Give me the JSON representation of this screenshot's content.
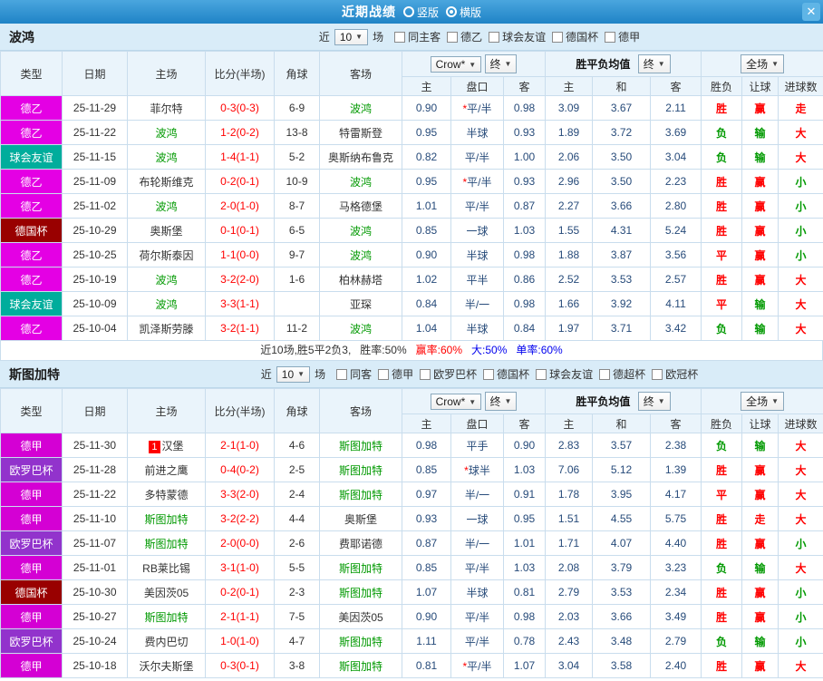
{
  "titlebar": {
    "title": "近期战绩",
    "options": [
      {
        "label": "竖版",
        "selected": false
      },
      {
        "label": "横版",
        "selected": true
      }
    ],
    "close_label": "✕"
  },
  "colors": {
    "red": "#ff0000",
    "green": "#009900",
    "blue": "#0000ee",
    "focal": "#009900",
    "score": "#ff0000",
    "league": {
      "德乙": "#e400e4",
      "德甲": "#d400d4",
      "球会友谊": "#00ad9c",
      "德国杯": "#990000",
      "欧罗巴杯": "#9233cc"
    }
  },
  "table_header": {
    "type": "类型",
    "date": "日期",
    "home": "主场",
    "score": "比分(半场)",
    "corner": "角球",
    "away": "客场",
    "bookmaker": "Crow*",
    "final": "终",
    "avg_label": "胜平负均值",
    "scope": "全场",
    "sub": {
      "home_odds": "主",
      "handicap": "盘口",
      "away_odds": "客",
      "win": "主",
      "draw": "和",
      "lose": "客",
      "result": "胜负",
      "asian": "让球",
      "goals": "进球数"
    }
  },
  "sections": [
    {
      "team": "波鸿",
      "filter": {
        "near": "近",
        "count": "10",
        "games": "场",
        "checkboxes": [
          "同主客",
          "德乙",
          "球会友谊",
          "德国杯",
          "德甲"
        ]
      },
      "rows": [
        {
          "league": "德乙",
          "date": "25-11-29",
          "home": "菲尔特",
          "home_focal": false,
          "score": "0-3(0-3)",
          "corner": "6-9",
          "away": "波鸿",
          "away_focal": true,
          "home_odds": "0.90",
          "handicap": "*平/半",
          "away_odds": "0.98",
          "avg_win": "3.09",
          "avg_draw": "3.67",
          "avg_lose": "2.11",
          "result": "胜",
          "result_color": "red",
          "asian": "赢",
          "asian_color": "red",
          "goals": "走",
          "goals_color": "red"
        },
        {
          "league": "德乙",
          "date": "25-11-22",
          "home": "波鸿",
          "home_focal": true,
          "score": "1-2(0-2)",
          "corner": "13-8",
          "away": "特雷斯登",
          "away_focal": false,
          "home_odds": "0.95",
          "handicap": "半球",
          "away_odds": "0.93",
          "avg_win": "1.89",
          "avg_draw": "3.72",
          "avg_lose": "3.69",
          "result": "负",
          "result_color": "green",
          "asian": "输",
          "asian_color": "green",
          "goals": "大",
          "goals_color": "red"
        },
        {
          "league": "球会友谊",
          "date": "25-11-15",
          "home": "波鸿",
          "home_focal": true,
          "score": "1-4(1-1)",
          "corner": "5-2",
          "away": "奥斯纳布鲁克",
          "away_focal": false,
          "home_odds": "0.82",
          "handicap": "平/半",
          "away_odds": "1.00",
          "avg_win": "2.06",
          "avg_draw": "3.50",
          "avg_lose": "3.04",
          "result": "负",
          "result_color": "green",
          "asian": "输",
          "asian_color": "green",
          "goals": "大",
          "goals_color": "red"
        },
        {
          "league": "德乙",
          "date": "25-11-09",
          "home": "布轮斯维克",
          "home_focal": false,
          "score": "0-2(0-1)",
          "corner": "10-9",
          "away": "波鸿",
          "away_focal": true,
          "home_odds": "0.95",
          "handicap": "*平/半",
          "away_odds": "0.93",
          "avg_win": "2.96",
          "avg_draw": "3.50",
          "avg_lose": "2.23",
          "result": "胜",
          "result_color": "red",
          "asian": "赢",
          "asian_color": "red",
          "goals": "小",
          "goals_color": "green"
        },
        {
          "league": "德乙",
          "date": "25-11-02",
          "home": "波鸿",
          "home_focal": true,
          "score": "2-0(1-0)",
          "corner": "8-7",
          "away": "马格德堡",
          "away_focal": false,
          "home_odds": "1.01",
          "handicap": "平/半",
          "away_odds": "0.87",
          "avg_win": "2.27",
          "avg_draw": "3.66",
          "avg_lose": "2.80",
          "result": "胜",
          "result_color": "red",
          "asian": "赢",
          "asian_color": "red",
          "goals": "小",
          "goals_color": "green"
        },
        {
          "league": "德国杯",
          "date": "25-10-29",
          "home": "奥斯堡",
          "home_focal": false,
          "score": "0-1(0-1)",
          "corner": "6-5",
          "away": "波鸿",
          "away_focal": true,
          "home_odds": "0.85",
          "handicap": "一球",
          "away_odds": "1.03",
          "avg_win": "1.55",
          "avg_draw": "4.31",
          "avg_lose": "5.24",
          "result": "胜",
          "result_color": "red",
          "asian": "赢",
          "asian_color": "red",
          "goals": "小",
          "goals_color": "green"
        },
        {
          "league": "德乙",
          "date": "25-10-25",
          "home": "荷尔斯泰因",
          "home_focal": false,
          "score": "1-1(0-0)",
          "corner": "9-7",
          "away": "波鸿",
          "away_focal": true,
          "home_odds": "0.90",
          "handicap": "半球",
          "away_odds": "0.98",
          "avg_win": "1.88",
          "avg_draw": "3.87",
          "avg_lose": "3.56",
          "result": "平",
          "result_color": "red",
          "asian": "赢",
          "asian_color": "red",
          "goals": "小",
          "goals_color": "green"
        },
        {
          "league": "德乙",
          "date": "25-10-19",
          "home": "波鸿",
          "home_focal": true,
          "score": "3-2(2-0)",
          "corner": "1-6",
          "away": "柏林赫塔",
          "away_focal": false,
          "home_odds": "1.02",
          "handicap": "平半",
          "away_odds": "0.86",
          "avg_win": "2.52",
          "avg_draw": "3.53",
          "avg_lose": "2.57",
          "result": "胜",
          "result_color": "red",
          "asian": "赢",
          "asian_color": "red",
          "goals": "大",
          "goals_color": "red"
        },
        {
          "league": "球会友谊",
          "date": "25-10-09",
          "home": "波鸿",
          "home_focal": true,
          "score": "3-3(1-1)",
          "corner": "",
          "away": "亚琛",
          "away_focal": false,
          "home_odds": "0.84",
          "handicap": "半/一",
          "away_odds": "0.98",
          "avg_win": "1.66",
          "avg_draw": "3.92",
          "avg_lose": "4.11",
          "result": "平",
          "result_color": "red",
          "asian": "输",
          "asian_color": "green",
          "goals": "大",
          "goals_color": "red"
        },
        {
          "league": "德乙",
          "date": "25-10-04",
          "home": "凯泽斯劳滕",
          "home_focal": false,
          "score": "3-2(1-1)",
          "corner": "11-2",
          "away": "波鸿",
          "away_focal": true,
          "home_odds": "1.04",
          "handicap": "半球",
          "away_odds": "0.84",
          "avg_win": "1.97",
          "avg_draw": "3.71",
          "avg_lose": "3.42",
          "result": "负",
          "result_color": "green",
          "asian": "输",
          "asian_color": "green",
          "goals": "大",
          "goals_color": "red"
        }
      ],
      "summary": [
        {
          "text": "近10场,胜5平2负3,",
          "color": "#333333"
        },
        {
          "text": "胜率:50%",
          "color": "#333333"
        },
        {
          "text": "赢率:60%",
          "color": "#ff0000"
        },
        {
          "text": "大:50%",
          "color": "#0000ee"
        },
        {
          "text": "单率:60%",
          "color": "#0000ee"
        }
      ]
    },
    {
      "team": "斯图加特",
      "filter": {
        "near": "近",
        "count": "10",
        "games": "场",
        "checkboxes": [
          "同客",
          "德甲",
          "欧罗巴杯",
          "德国杯",
          "球会友谊",
          "德超杯",
          "欧冠杯"
        ]
      },
      "rows": [
        {
          "league": "德甲",
          "date": "25-11-30",
          "home": "汉堡",
          "home_badge": "1",
          "home_focal": false,
          "score": "2-1(1-0)",
          "corner": "4-6",
          "away": "斯图加特",
          "away_focal": true,
          "home_odds": "0.98",
          "handicap": "平手",
          "away_odds": "0.90",
          "avg_win": "2.83",
          "avg_draw": "3.57",
          "avg_lose": "2.38",
          "result": "负",
          "result_color": "green",
          "asian": "输",
          "asian_color": "green",
          "goals": "大",
          "goals_color": "red"
        },
        {
          "league": "欧罗巴杯",
          "date": "25-11-28",
          "home": "前进之鹰",
          "home_focal": false,
          "score": "0-4(0-2)",
          "corner": "2-5",
          "away": "斯图加特",
          "away_focal": true,
          "home_odds": "0.85",
          "handicap": "*球半",
          "away_odds": "1.03",
          "avg_win": "7.06",
          "avg_draw": "5.12",
          "avg_lose": "1.39",
          "result": "胜",
          "result_color": "red",
          "asian": "赢",
          "asian_color": "red",
          "goals": "大",
          "goals_color": "red"
        },
        {
          "league": "德甲",
          "date": "25-11-22",
          "home": "多特蒙德",
          "home_focal": false,
          "score": "3-3(2-0)",
          "corner": "2-4",
          "away": "斯图加特",
          "away_focal": true,
          "home_odds": "0.97",
          "handicap": "半/一",
          "away_odds": "0.91",
          "avg_win": "1.78",
          "avg_draw": "3.95",
          "avg_lose": "4.17",
          "result": "平",
          "result_color": "red",
          "asian": "赢",
          "asian_color": "red",
          "goals": "大",
          "goals_color": "red"
        },
        {
          "league": "德甲",
          "date": "25-11-10",
          "home": "斯图加特",
          "home_focal": true,
          "score": "3-2(2-2)",
          "corner": "4-4",
          "away": "奥斯堡",
          "away_focal": false,
          "home_odds": "0.93",
          "handicap": "一球",
          "away_odds": "0.95",
          "avg_win": "1.51",
          "avg_draw": "4.55",
          "avg_lose": "5.75",
          "result": "胜",
          "result_color": "red",
          "asian": "走",
          "asian_color": "red",
          "goals": "大",
          "goals_color": "red"
        },
        {
          "league": "欧罗巴杯",
          "date": "25-11-07",
          "home": "斯图加特",
          "home_focal": true,
          "score": "2-0(0-0)",
          "corner": "2-6",
          "away": "费耶诺德",
          "away_focal": false,
          "home_odds": "0.87",
          "handicap": "半/一",
          "away_odds": "1.01",
          "avg_win": "1.71",
          "avg_draw": "4.07",
          "avg_lose": "4.40",
          "result": "胜",
          "result_color": "red",
          "asian": "赢",
          "asian_color": "red",
          "goals": "小",
          "goals_color": "green"
        },
        {
          "league": "德甲",
          "date": "25-11-01",
          "home": "RB莱比锡",
          "home_focal": false,
          "score": "3-1(1-0)",
          "corner": "5-5",
          "away": "斯图加特",
          "away_focal": true,
          "home_odds": "0.85",
          "handicap": "平/半",
          "away_odds": "1.03",
          "avg_win": "2.08",
          "avg_draw": "3.79",
          "avg_lose": "3.23",
          "result": "负",
          "result_color": "green",
          "asian": "输",
          "asian_color": "green",
          "goals": "大",
          "goals_color": "red"
        },
        {
          "league": "德国杯",
          "date": "25-10-30",
          "home": "美因茨05",
          "home_focal": false,
          "score": "0-2(0-1)",
          "corner": "2-3",
          "away": "斯图加特",
          "away_focal": true,
          "home_odds": "1.07",
          "handicap": "半球",
          "away_odds": "0.81",
          "avg_win": "2.79",
          "avg_draw": "3.53",
          "avg_lose": "2.34",
          "result": "胜",
          "result_color": "red",
          "asian": "赢",
          "asian_color": "red",
          "goals": "小",
          "goals_color": "green"
        },
        {
          "league": "德甲",
          "date": "25-10-27",
          "home": "斯图加特",
          "home_focal": true,
          "score": "2-1(1-1)",
          "corner": "7-5",
          "away": "美因茨05",
          "away_focal": false,
          "home_odds": "0.90",
          "handicap": "平/半",
          "away_odds": "0.98",
          "avg_win": "2.03",
          "avg_draw": "3.66",
          "avg_lose": "3.49",
          "result": "胜",
          "result_color": "red",
          "asian": "赢",
          "asian_color": "red",
          "goals": "小",
          "goals_color": "green"
        },
        {
          "league": "欧罗巴杯",
          "date": "25-10-24",
          "home": "费内巴切",
          "home_focal": false,
          "score": "1-0(1-0)",
          "corner": "4-7",
          "away": "斯图加特",
          "away_focal": true,
          "home_odds": "1.11",
          "handicap": "平/半",
          "away_odds": "0.78",
          "avg_win": "2.43",
          "avg_draw": "3.48",
          "avg_lose": "2.79",
          "result": "负",
          "result_color": "green",
          "asian": "输",
          "asian_color": "green",
          "goals": "小",
          "goals_color": "green"
        },
        {
          "league": "德甲",
          "date": "25-10-18",
          "home": "沃尔夫斯堡",
          "home_focal": false,
          "score": "0-3(0-1)",
          "corner": "3-8",
          "away": "斯图加特",
          "away_focal": true,
          "home_odds": "0.81",
          "handicap": "*平/半",
          "away_odds": "1.07",
          "avg_win": "3.04",
          "avg_draw": "3.58",
          "avg_lose": "2.40",
          "result": "胜",
          "result_color": "red",
          "asian": "赢",
          "asian_color": "red",
          "goals": "大",
          "goals_color": "red"
        }
      ]
    }
  ]
}
